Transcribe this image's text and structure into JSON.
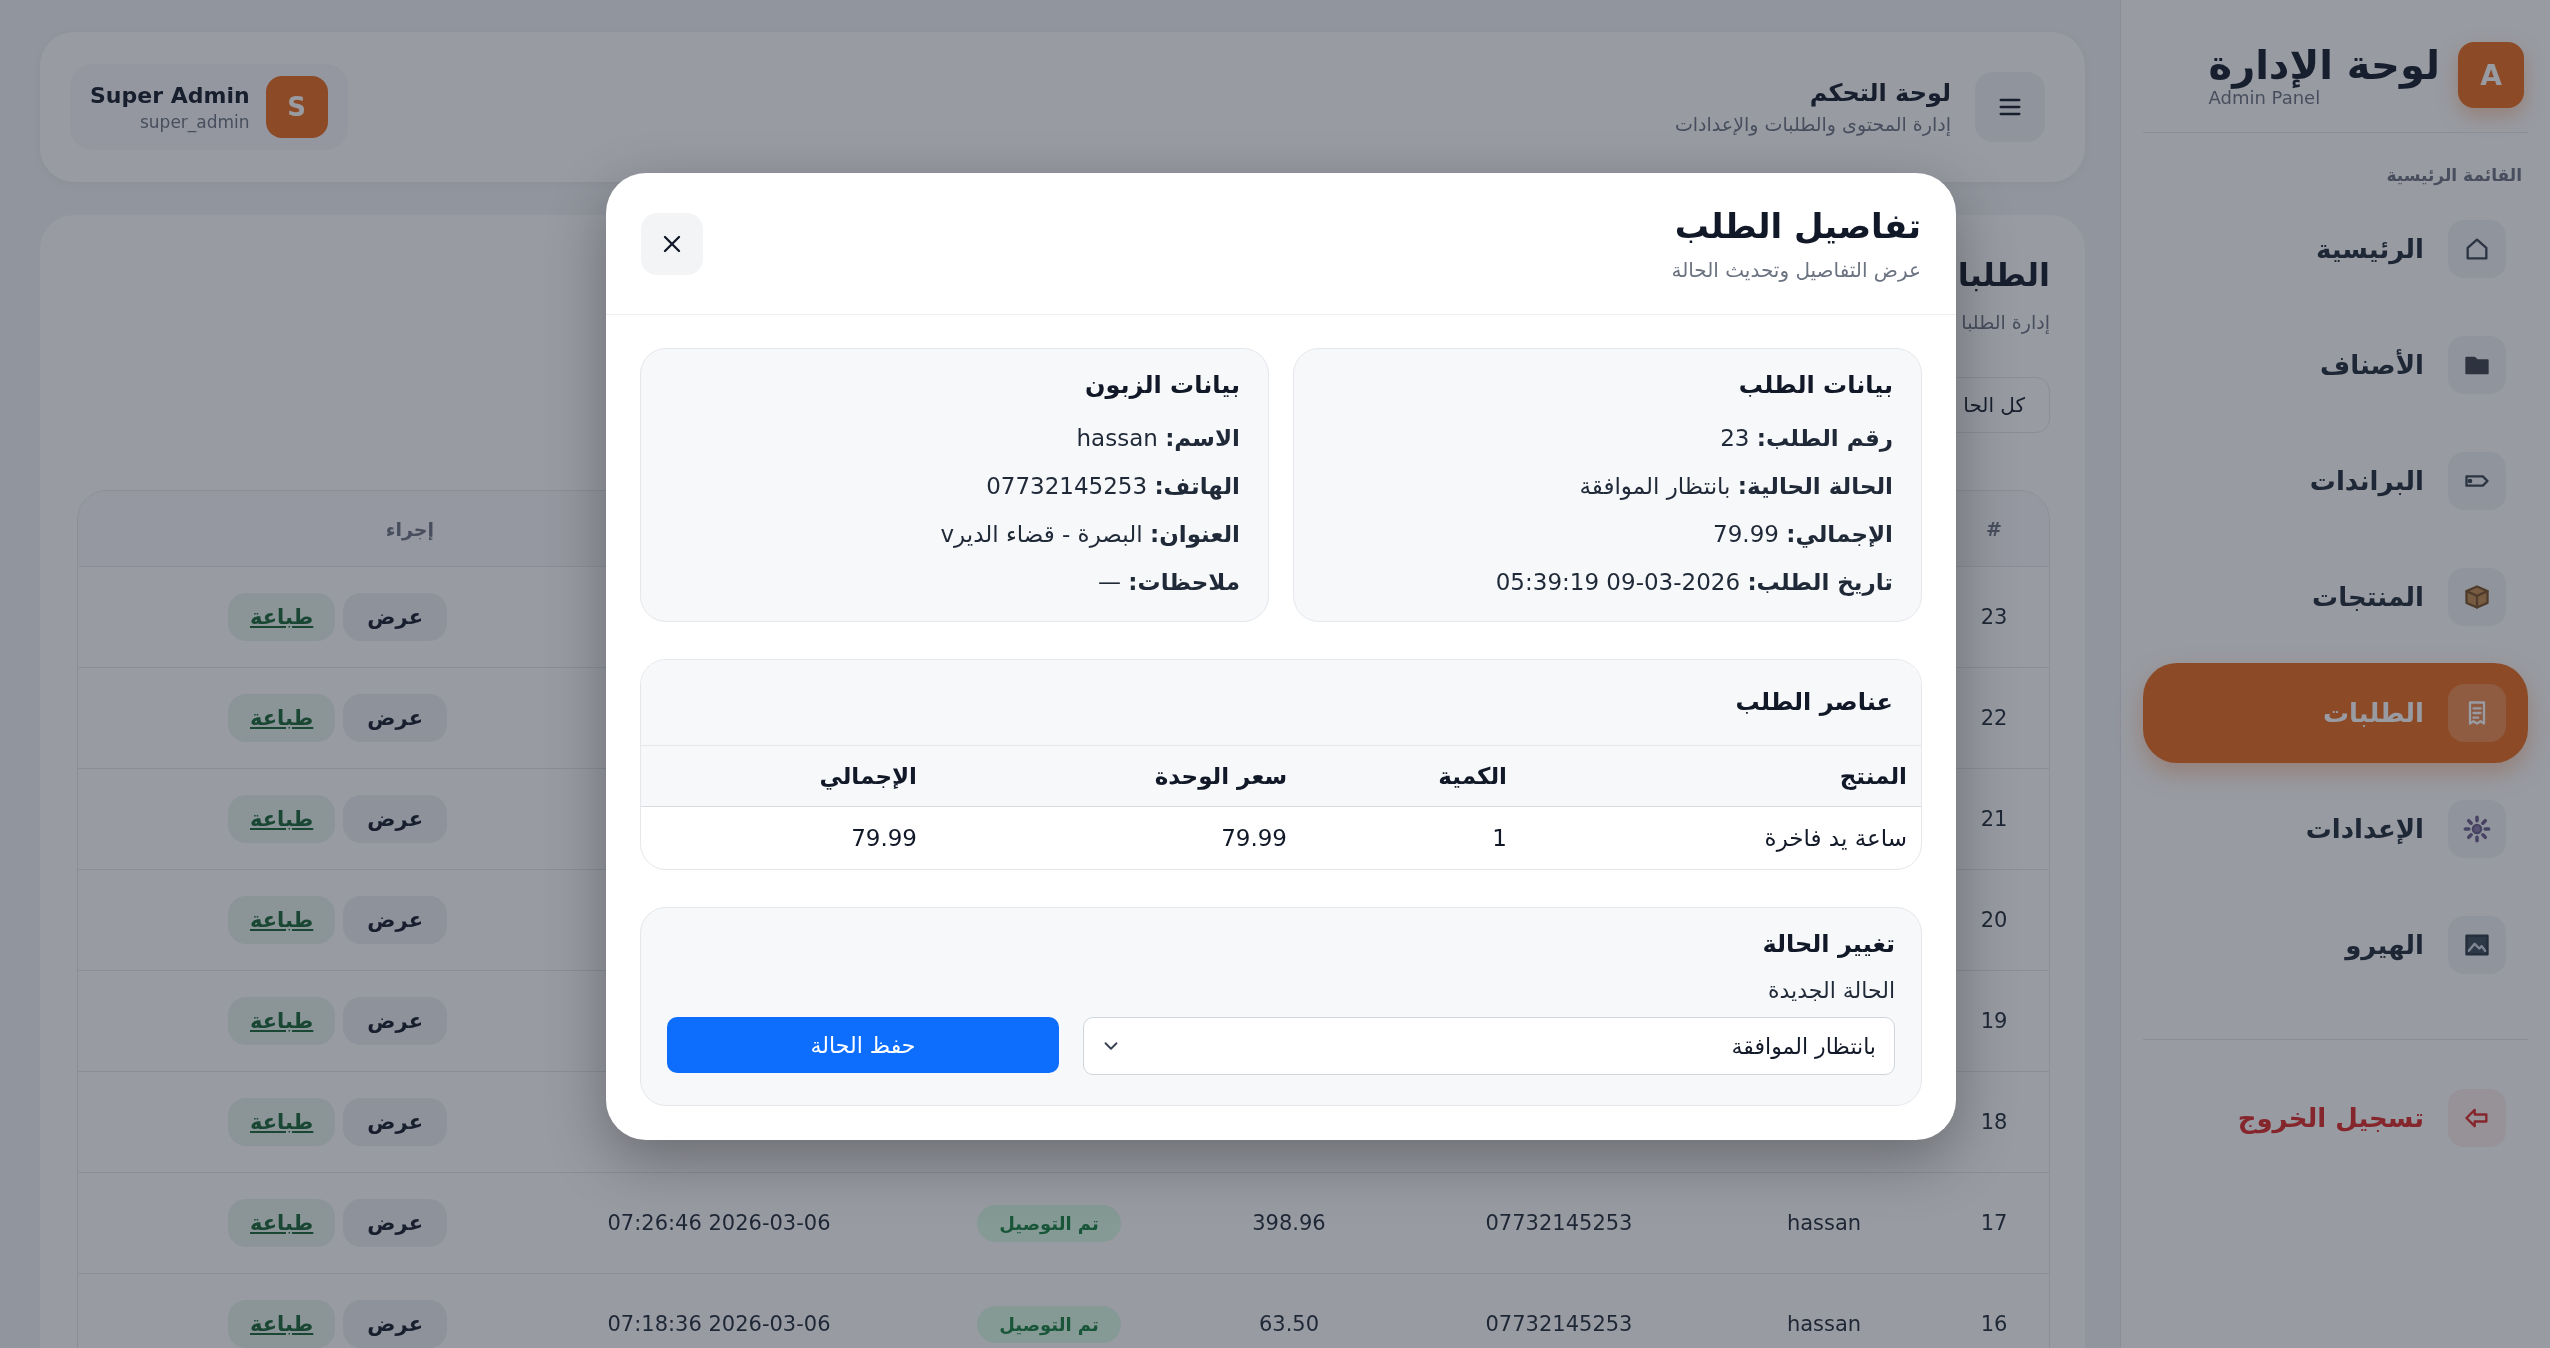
{
  "sidebar": {
    "brand": {
      "avatar": "A",
      "title": "لوحة الإدارة",
      "subtitle": "Admin Panel"
    },
    "section_label": "القائمة الرئيسية",
    "items": [
      {
        "label": "الرئيسية",
        "selected": false
      },
      {
        "label": "الأصناف",
        "selected": false
      },
      {
        "label": "البراندات",
        "selected": false
      },
      {
        "label": "المنتجات",
        "selected": false
      },
      {
        "label": "الطلبات",
        "selected": true
      },
      {
        "label": "الإعدادات",
        "selected": false
      },
      {
        "label": "الهيرو",
        "selected": false
      }
    ],
    "logout": "تسجيل الخروج"
  },
  "header": {
    "title": "لوحة التحكم",
    "subtitle": "إدارة المحتوى والطلبات والإعدادات",
    "user": {
      "avatar": "S",
      "name": "Super Admin",
      "username": "super_admin"
    }
  },
  "content": {
    "title": "الطلبا",
    "subtitle": "إدارة الطلبا",
    "filter_button": "كل الحا",
    "table": {
      "columns": [
        {
          "kind": "number",
          "label": "#"
        },
        {
          "kind": "actions",
          "label": "إجراء"
        }
      ],
      "rows": [
        {
          "number": "23",
          "actions": {
            "view": "عرض",
            "print": "طباعة"
          }
        },
        {
          "number": "22",
          "actions": {
            "view": "عرض",
            "print": "طباعة"
          }
        },
        {
          "number": "21",
          "actions": {
            "view": "عرض",
            "print": "طباعة"
          }
        },
        {
          "number": "20",
          "actions": {
            "view": "عرض",
            "print": "طباعة"
          }
        },
        {
          "number": "19",
          "actions": {
            "view": "عرض",
            "print": "طباعة"
          }
        },
        {
          "number": "18",
          "actions": {
            "view": "عرض",
            "print": "طباعة"
          }
        },
        {
          "number": "17",
          "name": "hassan",
          "phone": "07732145253",
          "total": "398.96",
          "status": "تم التوصيل",
          "date": "2026-03-06 07:26:46",
          "actions": {
            "view": "عرض",
            "print": "طباعة"
          }
        },
        {
          "number": "16",
          "name": "hassan",
          "phone": "07732145253",
          "total": "63.50",
          "status": "تم التوصيل",
          "date": "2026-03-06 07:18:36",
          "actions": {
            "view": "عرض",
            "print": "طباعة"
          }
        }
      ]
    }
  },
  "modal": {
    "title": "تفاصيل الطلب",
    "subtitle": "عرض التفاصيل وتحديث الحالة",
    "order_info": {
      "heading": "بيانات الطلب",
      "fields": [
        {
          "label": "رقم الطلب:",
          "value": "23"
        },
        {
          "label": "الحالة الحالية:",
          "value": "بانتظار الموافقة"
        },
        {
          "label": "الإجمالي:",
          "value": "79.99"
        },
        {
          "label": "تاريخ الطلب:",
          "value": "2026-03-09 05:39:19"
        }
      ]
    },
    "customer_info": {
      "heading": "بيانات الزبون",
      "fields": [
        {
          "label": "الاسم:",
          "value": "hassan"
        },
        {
          "label": "الهاتف:",
          "value": "07732145253"
        },
        {
          "label": "العنوان:",
          "value": "البصرة - قضاء الديرv"
        },
        {
          "label": "ملاحظات:",
          "value": "—"
        }
      ]
    },
    "items": {
      "heading": "عناصر الطلب",
      "columns": [
        "المنتج",
        "الكمية",
        "سعر الوحدة",
        "الإجمالي"
      ],
      "rows": [
        [
          "ساعة يد فاخرة",
          "1",
          "79.99",
          "79.99"
        ]
      ]
    },
    "status_change": {
      "heading": "تغيير الحالة",
      "field_label": "الحالة الجديدة",
      "select_value": "بانتظار الموافقة",
      "save_button": "حفظ الحالة"
    }
  }
}
